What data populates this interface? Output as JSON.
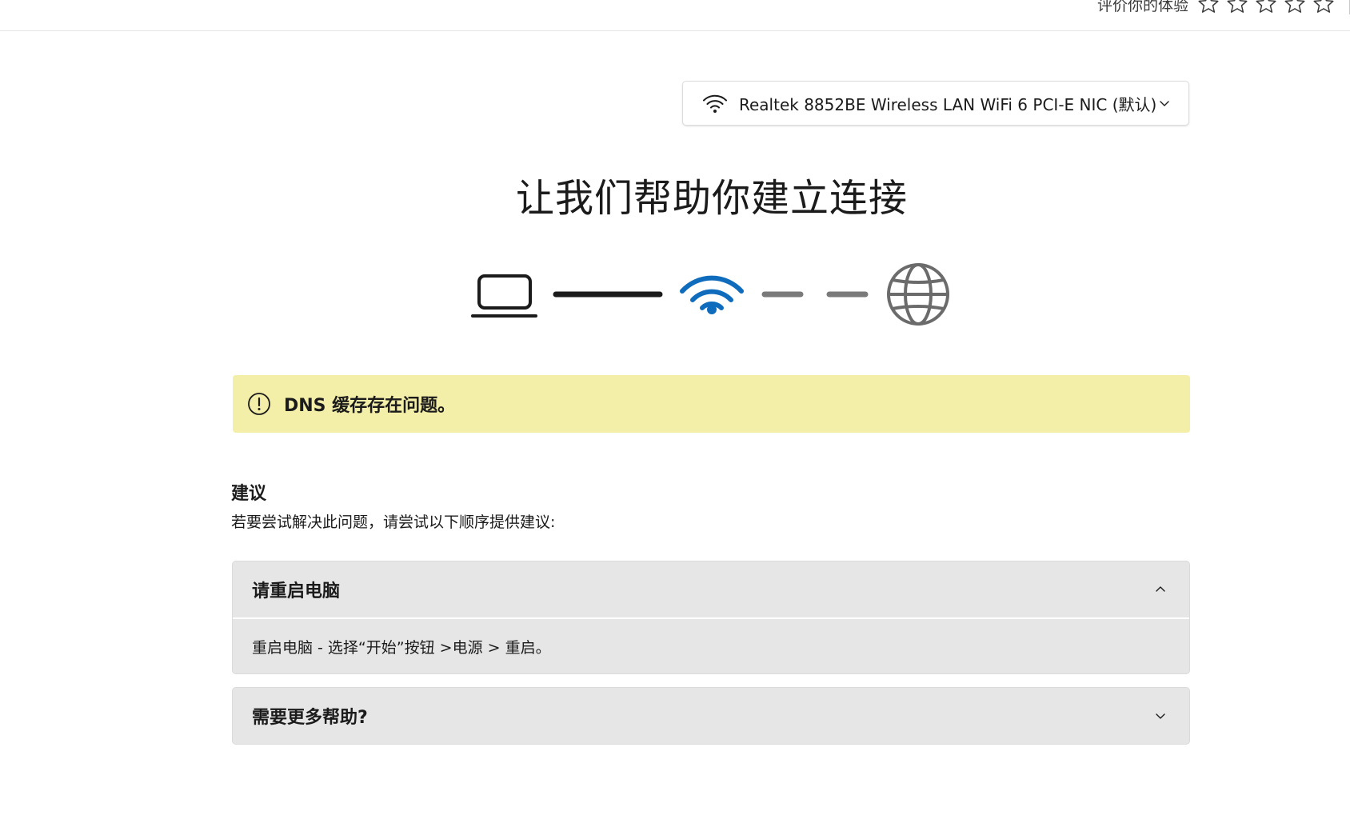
{
  "rating": {
    "label": "评价你的体验",
    "stars": 5,
    "value": 0
  },
  "adapter": {
    "icon": "wifi-icon",
    "label": "Realtek 8852BE Wireless LAN WiFi 6 PCI-E NIC (默认)"
  },
  "title": "让我们帮助你建立连接",
  "diagram": {
    "icons": [
      "laptop-icon",
      "wifi-icon",
      "globe-icon"
    ],
    "accent": "#0f6cbd",
    "link_connected": true,
    "internet_connected": false
  },
  "banner": {
    "icon": "warning-icon",
    "text": "DNS 缓存存在问题。",
    "color": "#f3eea8"
  },
  "suggestions": {
    "heading": "建议",
    "description": "若要尝试解决此问题，请尝试以下顺序提供建议:"
  },
  "accordions": [
    {
      "title": "请重启电脑",
      "expanded": true,
      "body": "重启电脑 - 选择“开始”按钮 >电源 > 重启。"
    },
    {
      "title": "需要更多帮助?",
      "expanded": false
    }
  ]
}
